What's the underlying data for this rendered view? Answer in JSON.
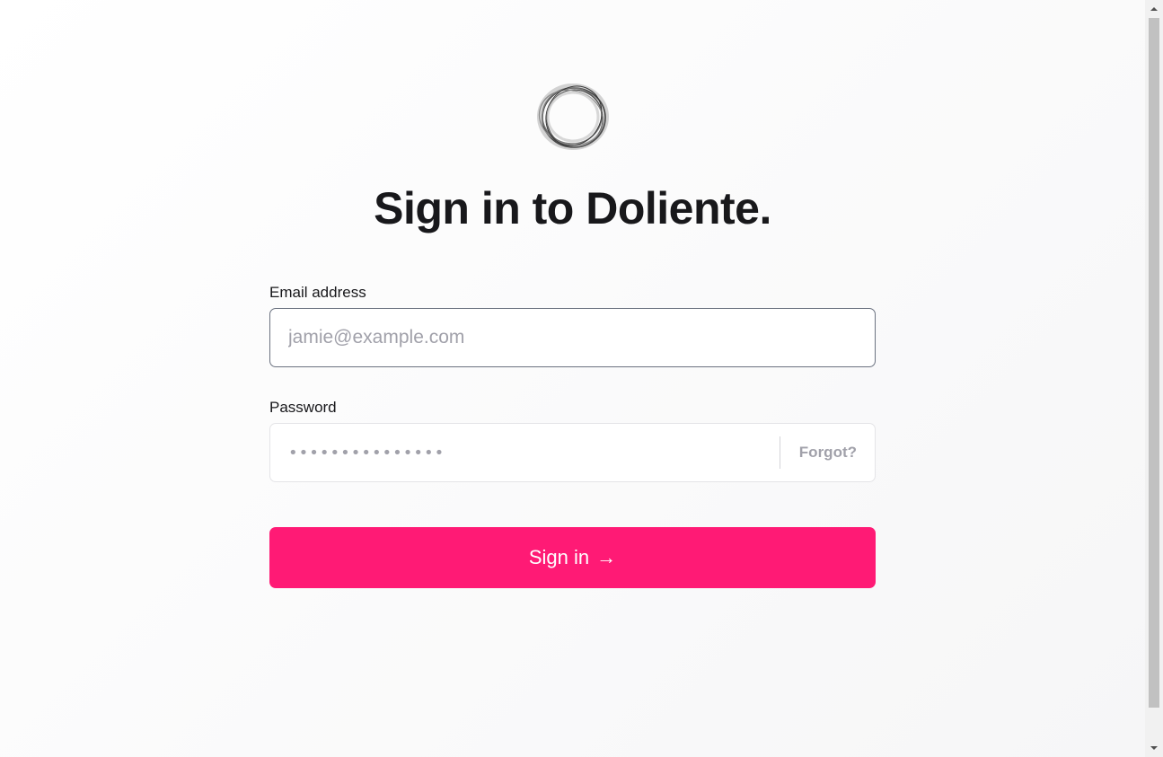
{
  "logo": {
    "icon": "ring-logo-icon",
    "colors": [
      "#3a3a3a",
      "#9a9a9a"
    ]
  },
  "title": "Sign in to Doliente.",
  "email": {
    "label": "Email address",
    "placeholder": "jamie@example.com",
    "value": ""
  },
  "password": {
    "label": "Password",
    "masked_value": "•••••••••••••••",
    "forgot_label": "Forgot?"
  },
  "submit": {
    "label": "Sign in",
    "arrow": "→",
    "color": "#ff1a75"
  },
  "scrollbar": {
    "up_icon": "scroll-up-arrow-icon",
    "down_icon": "scroll-down-arrow-icon"
  }
}
